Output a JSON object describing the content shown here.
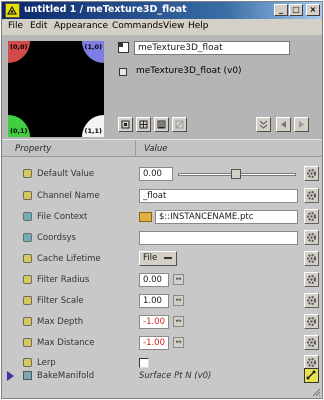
{
  "window": {
    "title": "untitled 1 / meTexture3D_float",
    "buttons": {
      "minimize": "_",
      "maximize": "□",
      "close": "×"
    }
  },
  "menu": [
    "File",
    "Edit",
    "Appearance",
    "Commands",
    "View",
    "Help"
  ],
  "preview": {
    "corners": {
      "top_left": "(0,0)",
      "top_right": "(1,0)",
      "bottom_left": "(0,1)",
      "bottom_right": "(1,1)"
    },
    "colors": {
      "top_left": "#d24b4b",
      "top_right": "#7d7de6",
      "bottom_left": "#3fcf3f",
      "bottom_right": "#f4f4f4"
    }
  },
  "node": {
    "name": "meTexture3D_float",
    "output": "meTexture3D_float (v0)"
  },
  "toolbar": {
    "icons": [
      "preview-icon",
      "grid-icon",
      "list-icon",
      "disabled-icon",
      "collapse-icon",
      "back-icon",
      "forward-icon"
    ]
  },
  "header": {
    "property": "Property",
    "value": "Value"
  },
  "params": {
    "default_value": {
      "label": "Default Value",
      "value": "0.00",
      "slider": 0.47
    },
    "channel_name": {
      "label": "Channel Name",
      "value": "_float"
    },
    "file_context": {
      "label": "File Context",
      "value": "$::INSTANCENAME.ptc"
    },
    "coordsys": {
      "label": "Coordsys",
      "value": ""
    },
    "cache_lifetime": {
      "label": "Cache Lifetime",
      "value": "File"
    },
    "filter_radius": {
      "label": "Filter Radius",
      "value": "0.00"
    },
    "filter_scale": {
      "label": "Filter Scale",
      "value": "1.00"
    },
    "max_depth": {
      "label": "Max Depth",
      "value": "-1.00"
    },
    "max_distance": {
      "label": "Max Distance",
      "value": "-1.00"
    },
    "lerp": {
      "label": "Lerp",
      "checked": false
    },
    "bake_manifold": {
      "label": "BakeManifold",
      "value": "Surface Pt N (v0)"
    }
  }
}
